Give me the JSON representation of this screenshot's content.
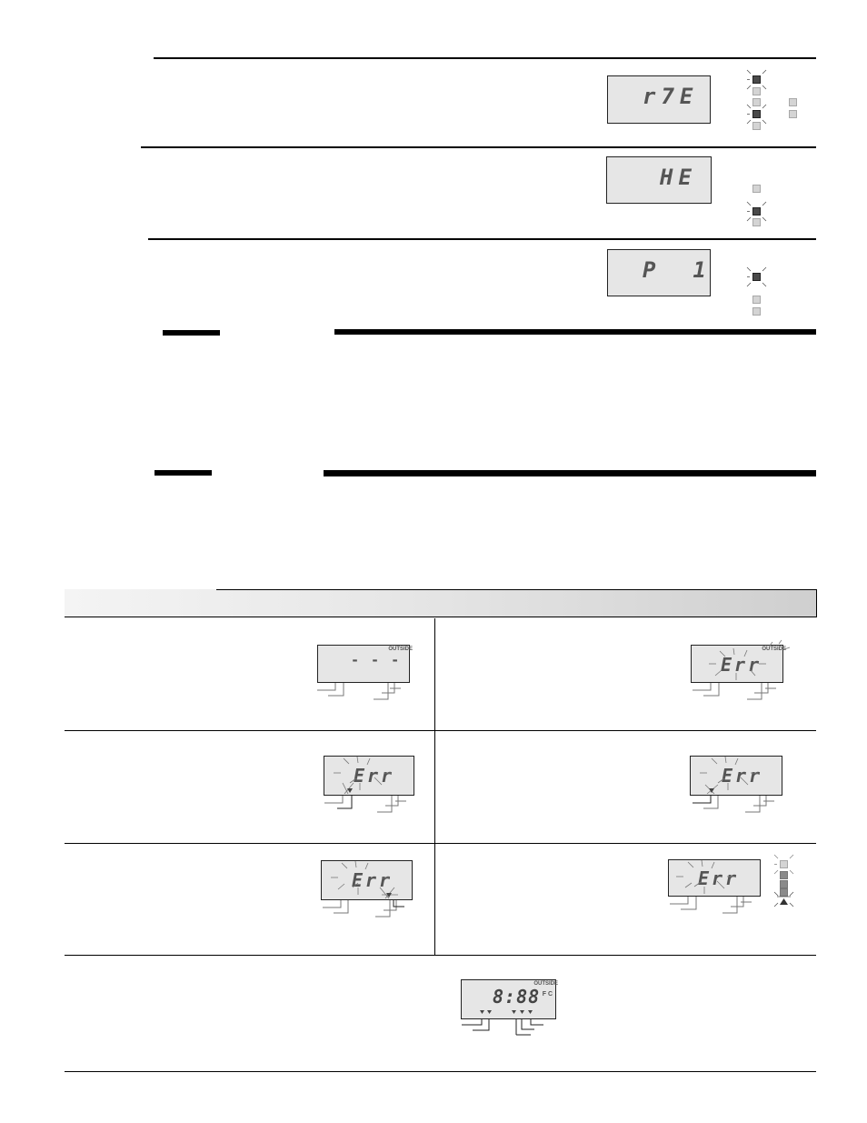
{
  "top_section": {
    "rows": [
      {
        "id": "row-1",
        "lcd_display": "r7E",
        "leds_left": [
          "flashing-on",
          "off",
          "off",
          "flashing-on",
          "off"
        ],
        "leds_right": [
          "off",
          "off"
        ]
      },
      {
        "id": "row-2",
        "lcd_display": "HE",
        "leds_left": [
          "off",
          "flashing-on",
          "off"
        ]
      },
      {
        "id": "row-3",
        "lcd_display": "P  1",
        "leds_left": [
          "flashing-on",
          "off",
          "off"
        ]
      }
    ]
  },
  "table": {
    "cells": [
      {
        "id": "cell-1",
        "lcd_display": "- - -",
        "label": "OUTSIDE",
        "flashing": false,
        "flashing_label": false
      },
      {
        "id": "cell-2",
        "lcd_display": "Err",
        "label": "OUTSIDE",
        "flashing": true,
        "flashing_label": true
      },
      {
        "id": "cell-3",
        "lcd_display": "Err",
        "flashing": true,
        "flashing_indicator": "left-1"
      },
      {
        "id": "cell-4",
        "lcd_display": "Err",
        "flashing": true,
        "flashing_indicator": "left-1"
      },
      {
        "id": "cell-5",
        "lcd_display": "Err",
        "flashing": true,
        "flashing_indicator": "right-3"
      },
      {
        "id": "cell-6",
        "lcd_display": "Err",
        "flashing": true,
        "leds": [
          "flashing-off",
          "mid",
          "mid",
          "mid",
          "flashing-on"
        ]
      }
    ],
    "footer_display": {
      "lcd_display": "8:88",
      "label": "OUTSIDE",
      "units": "F C"
    }
  }
}
